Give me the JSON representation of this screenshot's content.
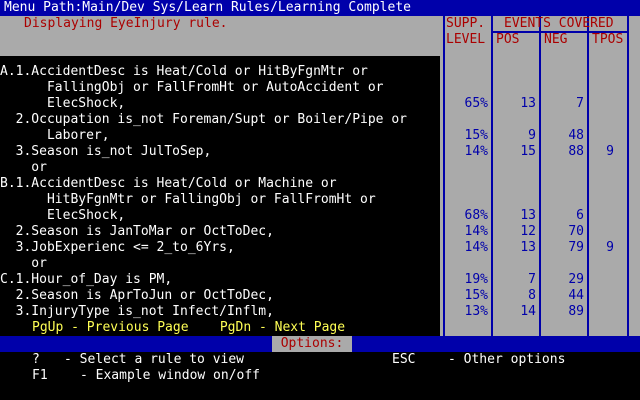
{
  "menu_path": "Menu Path:Main/Dev Sys/Learn Rules/Learning Complete",
  "status_message": "Displaying EyeInjury rule.",
  "table_headers": {
    "supp": "SUPP.",
    "level": "LEVEL",
    "events_covered": "EVENTS COVERED",
    "pos": "POS",
    "neg": "NEG",
    "tpos": "TPOS"
  },
  "rule_lines": [
    "A.1.AccidentDesc is Heat/Cold or HitByFgnMtr or",
    "      FallingObj or FallFromHt or AutoAccident or",
    "      ElecShock,",
    "  2.Occupation is_not Foreman/Supt or Boiler/Pipe or",
    "      Laborer,",
    "  3.Season is_not JulToSep,",
    "    or",
    "B.1.AccidentDesc is Heat/Cold or Machine or",
    "      HitByFgnMtr or FallingObj or FallFromHt or",
    "      ElecShock,",
    "  2.Season is JanToMar or OctToDec,",
    "  3.JobExperienc <= 2_to_6Yrs,",
    "    or",
    "C.1.Hour_of_Day is PM,",
    "  2.Season is AprToJun or OctToDec,",
    "  3.InjuryType is_not Infect/Inflm,"
  ],
  "stats_rows": [
    {
      "supp": "65%",
      "pos": "13",
      "neg": "7",
      "tpos": ""
    },
    {
      "supp": "15%",
      "pos": "9",
      "neg": "48",
      "tpos": ""
    },
    {
      "supp": "14%",
      "pos": "15",
      "neg": "88",
      "tpos": "9"
    },
    {
      "supp": "68%",
      "pos": "13",
      "neg": "6",
      "tpos": ""
    },
    {
      "supp": "14%",
      "pos": "12",
      "neg": "70",
      "tpos": ""
    },
    {
      "supp": "14%",
      "pos": "13",
      "neg": "79",
      "tpos": "9"
    },
    {
      "supp": "19%",
      "pos": "7",
      "neg": "29",
      "tpos": ""
    },
    {
      "supp": "15%",
      "pos": "8",
      "neg": "44",
      "tpos": ""
    },
    {
      "supp": "13%",
      "pos": "14",
      "neg": "89",
      "tpos": ""
    }
  ],
  "pager_text": "PgUp - Previous Page    PgDn - Next Page",
  "options_title": "Options:",
  "options": [
    {
      "key": "?",
      "desc": "- Select a rule to view"
    },
    {
      "key": "F1",
      "desc": "- Example window on/off"
    },
    {
      "key": "ESC",
      "desc": "- Other options"
    }
  ],
  "colors": {
    "background": "#000000",
    "bar_blue": "#0000AA",
    "panel_gray": "#AAAAAA",
    "header_red": "#AA0000",
    "pager_yellow": "#FFFF55",
    "text_white": "#FFFFFF"
  }
}
